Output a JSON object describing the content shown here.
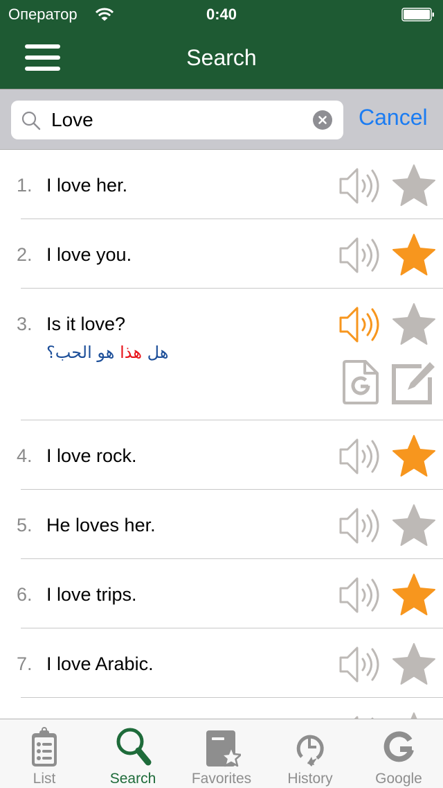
{
  "status_bar": {
    "carrier": "Оператор",
    "time": "0:40",
    "wifi_icon": "wifi-icon",
    "battery_icon": "battery-full-icon"
  },
  "nav": {
    "title": "Search",
    "menu_icon": "hamburger-menu-icon"
  },
  "search": {
    "value": "Love",
    "placeholder": "",
    "cancel_label": "Cancel",
    "search_icon": "magnifier-icon",
    "clear_icon": "clear-circle-icon"
  },
  "colors": {
    "header_bg": "#1e5a33",
    "accent_orange": "#f7961e",
    "icon_gray": "#bdb9b6",
    "link_blue": "#1b7cf2",
    "tab_active": "#1e6b3a",
    "translation_blue": "#1d4f99",
    "translation_highlight": "#e8141a"
  },
  "results": [
    {
      "number": "1.",
      "text": "I love her.",
      "favorite": false,
      "playing": false
    },
    {
      "number": "2.",
      "text": "I love you.",
      "favorite": true,
      "playing": false
    },
    {
      "number": "3.",
      "text": "Is it love?",
      "favorite": false,
      "playing": true,
      "expanded": true,
      "translation": {
        "before": "هل ",
        "highlight": "هذا",
        "after": " هو الحب؟"
      }
    },
    {
      "number": "4.",
      "text": "I love rock.",
      "favorite": true,
      "playing": false
    },
    {
      "number": "5.",
      "text": "He loves her.",
      "favorite": false,
      "playing": false
    },
    {
      "number": "6.",
      "text": "I love trips.",
      "favorite": true,
      "playing": false
    },
    {
      "number": "7.",
      "text": "I love Arabic.",
      "favorite": false,
      "playing": false
    },
    {
      "number": "",
      "text": "",
      "favorite": false,
      "playing": false
    }
  ],
  "tabs": [
    {
      "label": "List",
      "icon": "clipboard-list-icon",
      "active": false
    },
    {
      "label": "Search",
      "icon": "magnifier-icon",
      "active": true
    },
    {
      "label": "Favorites",
      "icon": "book-star-icon",
      "active": false
    },
    {
      "label": "History",
      "icon": "clock-history-icon",
      "active": false
    },
    {
      "label": "Google",
      "icon": "google-g-icon",
      "active": false
    }
  ]
}
